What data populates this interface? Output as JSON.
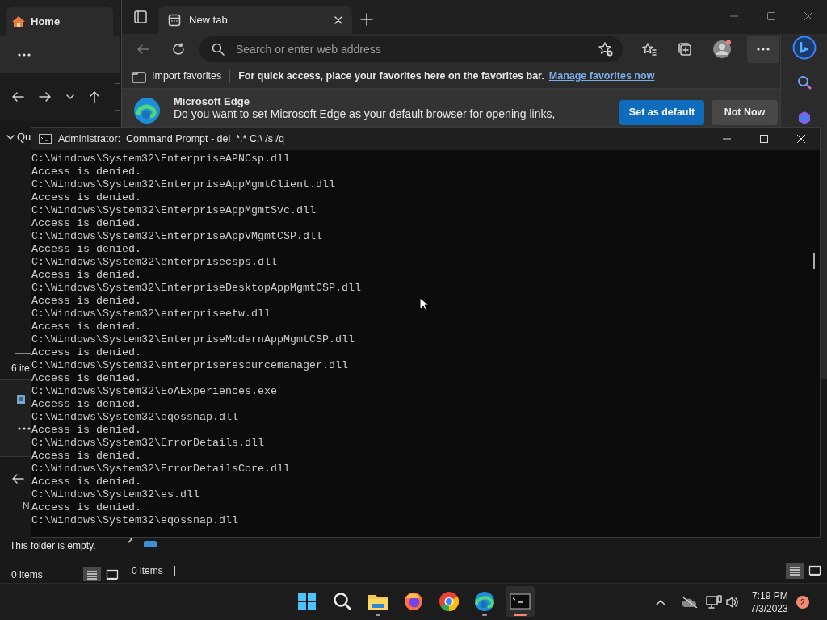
{
  "explorer_left": {
    "tab_title": "Home",
    "quick_access": "Qu",
    "status_partial": "6 ite",
    "partial_label": "N",
    "empty_message": "This folder is empty.",
    "status": "0 items",
    "view_buttons": [
      {
        "kind": "details",
        "selected": true
      },
      {
        "kind": "tiles",
        "selected": false
      }
    ]
  },
  "explorer_right": {
    "status": "0 items",
    "view_buttons": [
      {
        "kind": "details",
        "selected": true
      },
      {
        "kind": "tiles",
        "selected": false
      }
    ]
  },
  "browser": {
    "tabs": [
      {
        "title": "New tab",
        "selected": true
      }
    ],
    "address_placeholder": "Search or enter web address",
    "favorites_bar": {
      "import": "Import favorites",
      "hint": "For quick access, place your favorites here on the favorites bar.",
      "link": "Manage favorites now"
    },
    "banner": {
      "title": "Microsoft Edge",
      "message": "Do you want to set Microsoft Edge as your default browser for opening links,",
      "buttons": [
        {
          "label": "Set as default",
          "kind": "primary"
        },
        {
          "label": "Not Now",
          "kind": "secondary"
        }
      ]
    }
  },
  "terminal": {
    "title": "Administrator:  Command Prompt - del  *.* C:\\ /s /q",
    "lines": [
      "C:\\Windows\\System32\\EnterpriseAPNCsp.dll",
      "Access is denied.",
      "C:\\Windows\\System32\\EnterpriseAppMgmtClient.dll",
      "Access is denied.",
      "C:\\Windows\\System32\\EnterpriseAppMgmtSvc.dll",
      "Access is denied.",
      "C:\\Windows\\System32\\EnterpriseAppVMgmtCSP.dll",
      "Access is denied.",
      "C:\\Windows\\System32\\enterprisecsps.dll",
      "Access is denied.",
      "C:\\Windows\\System32\\EnterpriseDesktopAppMgmtCSP.dll",
      "Access is denied.",
      "C:\\Windows\\System32\\enterpriseetw.dll",
      "Access is denied.",
      "C:\\Windows\\System32\\EnterpriseModernAppMgmtCSP.dll",
      "Access is denied.",
      "C:\\Windows\\System32\\enterpriseresourcemanager.dll",
      "Access is denied.",
      "C:\\Windows\\System32\\EoAExperiences.exe",
      "Access is denied.",
      "C:\\Windows\\System32\\eqossnap.dll",
      "Access is denied.",
      "C:\\Windows\\System32\\ErrorDetails.dll",
      "Access is denied.",
      "C:\\Windows\\System32\\ErrorDetailsCore.dll",
      "Access is denied.",
      "C:\\Windows\\System32\\es.dll",
      "Access is denied.",
      "C:\\Windows\\System32\\eqossnap.dll"
    ]
  },
  "taskbar": {
    "apps": [
      {
        "kind": "start",
        "running": false,
        "active": false
      },
      {
        "kind": "search",
        "running": false,
        "active": false
      },
      {
        "kind": "files",
        "running": true,
        "active": false
      },
      {
        "kind": "firefox",
        "running": false,
        "active": false
      },
      {
        "kind": "chrome",
        "running": false,
        "active": false
      },
      {
        "kind": "edge",
        "running": true,
        "active": false
      },
      {
        "kind": "terminal",
        "running": true,
        "active": true
      }
    ],
    "time": "7:19 PM",
    "date": "7/3/2023",
    "notifications": "2"
  }
}
